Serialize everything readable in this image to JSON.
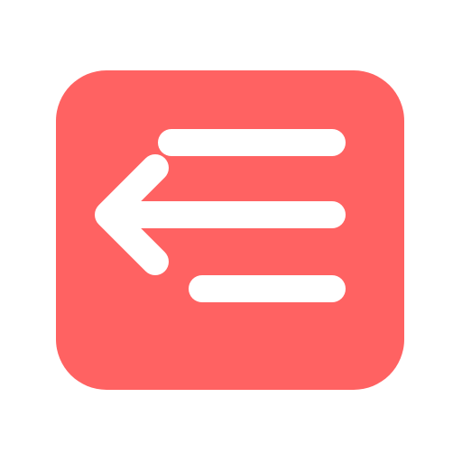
{
  "icon": {
    "name": "collapse-menu-icon",
    "background_color": "#ff6262",
    "glyph_color": "#ffffff"
  }
}
